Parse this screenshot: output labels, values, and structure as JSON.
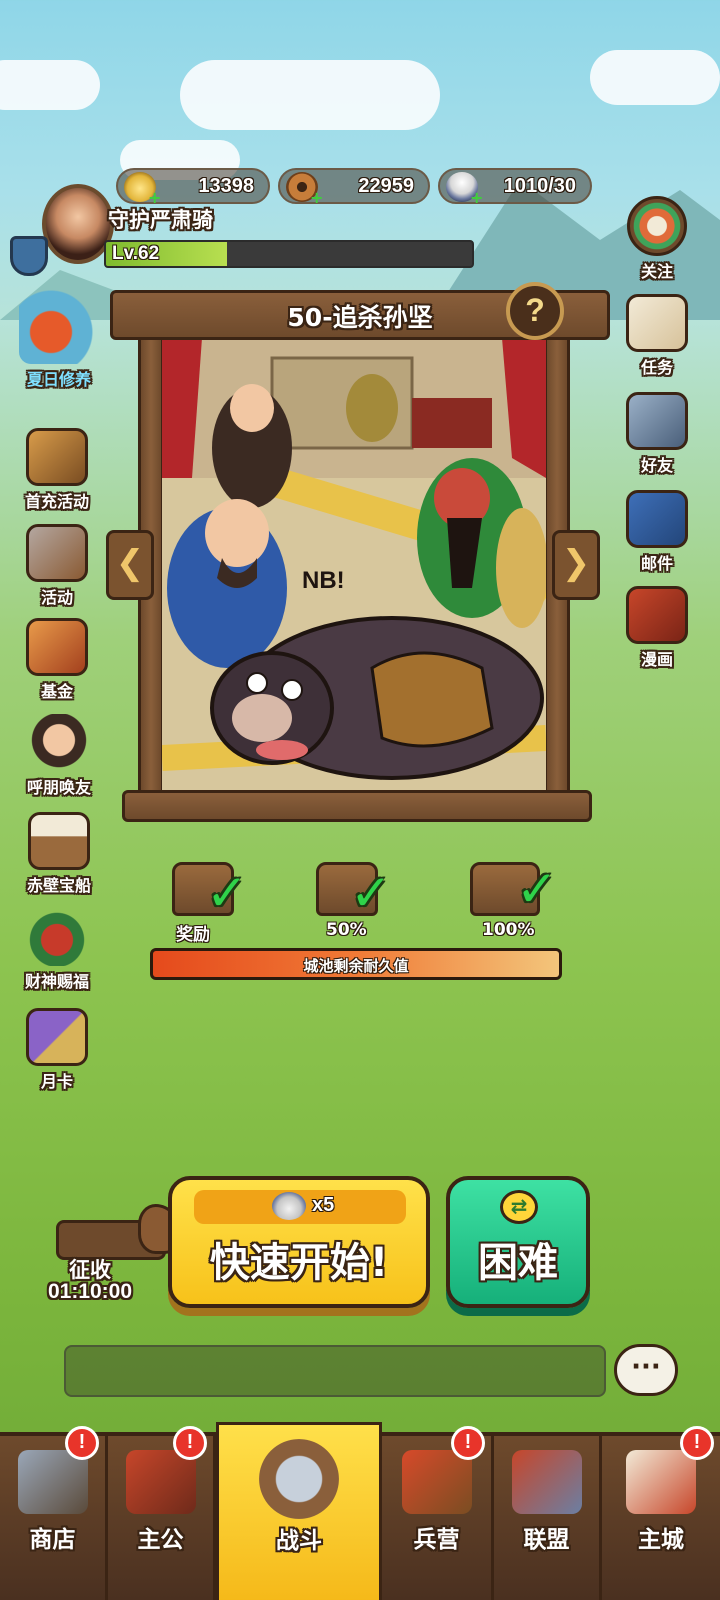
{
  "resources": {
    "gold": "13398",
    "copper": "22959",
    "food": "1010/30"
  },
  "player": {
    "name": "守护严肃骑",
    "level": "Lv.62",
    "exp_progress": 0.33
  },
  "left_menu": [
    {
      "label": "夏日修养",
      "icon": "summer-rest-icon"
    },
    {
      "label": "首充活动",
      "icon": "first-charge-icon"
    },
    {
      "label": "活动",
      "icon": "event-icon"
    },
    {
      "label": "基金",
      "icon": "fund-icon"
    },
    {
      "label": "呼朋唤友",
      "icon": "invite-friends-icon"
    },
    {
      "label": "赤壁宝船",
      "icon": "treasure-ship-icon"
    },
    {
      "label": "财神赐福",
      "icon": "fortune-god-icon"
    },
    {
      "label": "月卡",
      "icon": "monthly-card-icon"
    }
  ],
  "right_menu": [
    {
      "label": "关注",
      "icon": "follow-icon"
    },
    {
      "label": "任务",
      "icon": "quest-icon"
    },
    {
      "label": "好友",
      "icon": "friends-icon"
    },
    {
      "label": "邮件",
      "icon": "mail-icon"
    },
    {
      "label": "漫画",
      "icon": "comic-icon"
    }
  ],
  "stage": {
    "title": "50-追杀孙坚",
    "help_symbol": "?",
    "prev_symbol": "❮",
    "next_symbol": "❯",
    "art_text": "NB!"
  },
  "rewards": [
    {
      "label": "奖励",
      "claimed": true
    },
    {
      "label": "50%",
      "claimed": true
    },
    {
      "label": "100%",
      "claimed": true
    }
  ],
  "durability": {
    "label": "城池剩余耐久值",
    "value": 1.0
  },
  "quick_start": {
    "cost": "x5",
    "label": "快速开始!"
  },
  "hard_button": {
    "label": "困难"
  },
  "collect": {
    "label": "征收",
    "timer": "01:10:00"
  },
  "chat": {
    "button_symbol": "···"
  },
  "nav": [
    {
      "label": "商店",
      "badge": "!",
      "active": false
    },
    {
      "label": "主公",
      "badge": "!",
      "active": false
    },
    {
      "label": "战斗",
      "badge": "",
      "active": true
    },
    {
      "label": "兵营",
      "badge": "!",
      "active": false
    },
    {
      "label": "联盟",
      "badge": "",
      "active": false
    },
    {
      "label": "主城",
      "badge": "!",
      "active": false
    }
  ],
  "colors": {
    "accent_yellow": "#f7c21a",
    "accent_green": "#16b07a",
    "frame_brown": "#6e4a2c",
    "badge_red": "#e8342a"
  }
}
